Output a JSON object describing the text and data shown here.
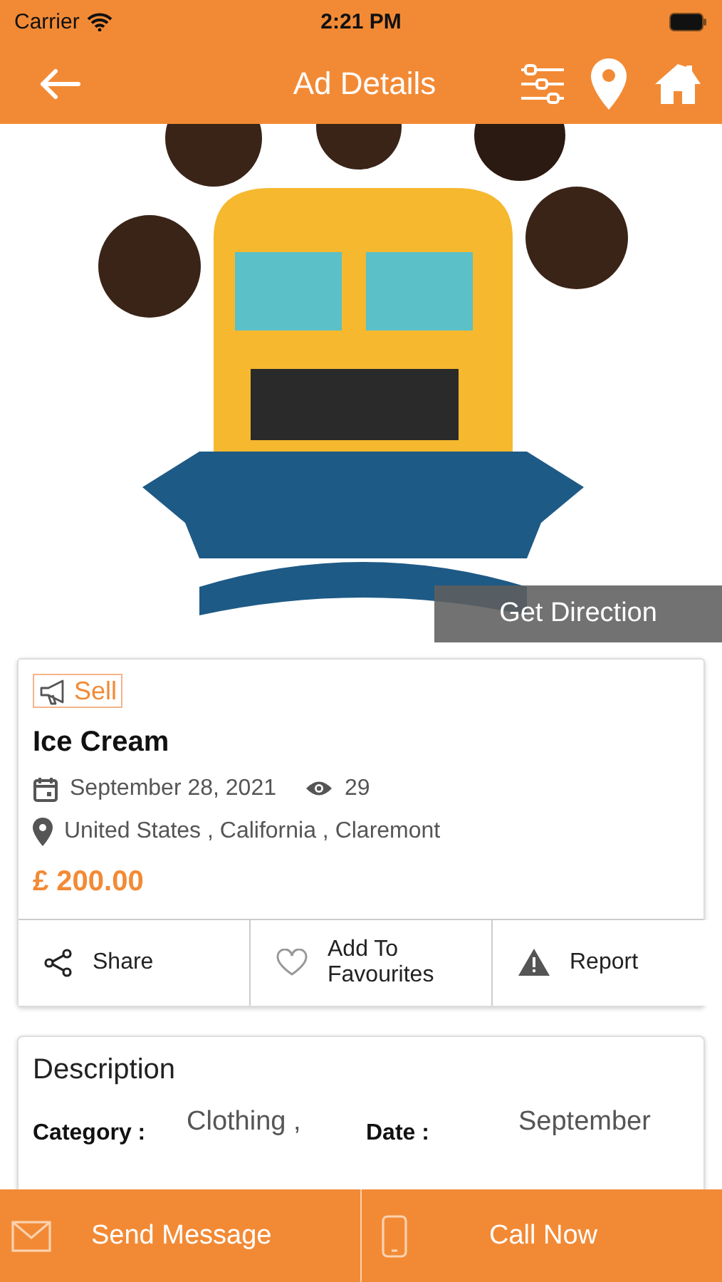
{
  "status_bar": {
    "carrier": "Carrier",
    "time": "2:21 PM"
  },
  "header": {
    "title": "Ad Details"
  },
  "hero": {
    "kind": "picture",
    "action": "Get Direction"
  },
  "ad": {
    "type_badge": "Sell",
    "title": "Ice Cream",
    "date": "September 28, 2021",
    "views": "29",
    "location": "United States , California , Claremont",
    "price": "£ 200.00"
  },
  "actions": [
    {
      "kind": "share",
      "label": "Share"
    },
    {
      "kind": "favourite",
      "label": "Add To Favourites"
    },
    {
      "kind": "report",
      "label": "Report"
    }
  ],
  "description": {
    "title": "Description",
    "fields": [
      {
        "label": "Category :",
        "value": "Clothing ,"
      },
      {
        "label": "Date :",
        "value": "September"
      }
    ]
  },
  "bottom_bar": [
    {
      "kind": "message",
      "label": "Send Message"
    },
    {
      "kind": "call",
      "label": "Call Now"
    }
  ]
}
